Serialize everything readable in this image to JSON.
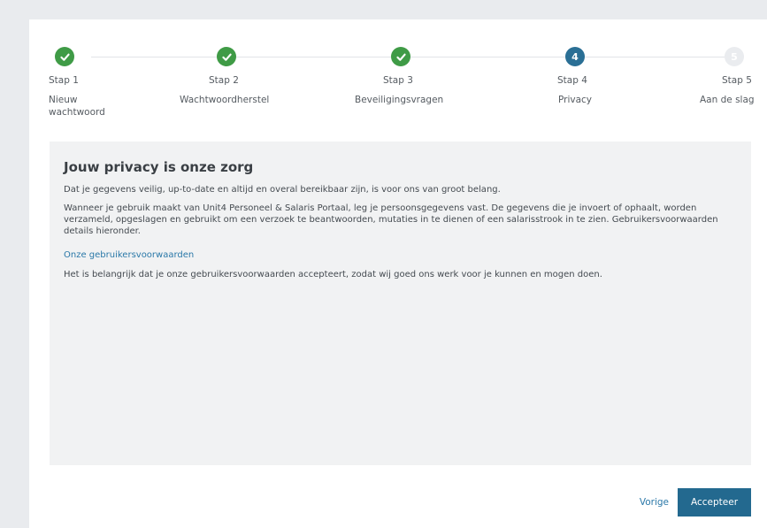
{
  "stepper": {
    "steps": [
      {
        "number": "1",
        "label": "Stap 1",
        "name": "Nieuw wachtwoord",
        "state": "done"
      },
      {
        "number": "2",
        "label": "Stap 2",
        "name": "Wachtwoordherstel",
        "state": "done"
      },
      {
        "number": "3",
        "label": "Stap 3",
        "name": "Beveiligingsvragen",
        "state": "done"
      },
      {
        "number": "4",
        "label": "Stap 4",
        "name": "Privacy",
        "state": "active"
      },
      {
        "number": "5",
        "label": "Stap 5",
        "name": "Aan de slag",
        "state": "future"
      }
    ]
  },
  "content": {
    "title": "Jouw privacy is onze zorg",
    "para1": "Dat je gegevens veilig, up-to-date en altijd en overal bereikbaar zijn, is voor ons van groot belang.",
    "para2": "Wanneer je gebruik maakt van Unit4 Personeel & Salaris Portaal, leg je persoonsgegevens vast. De gegevens die je invoert of ophaalt, worden verzameld, opgeslagen en gebruikt om een verzoek te beantwoorden, mutaties in te dienen of een salarisstrook in te zien. Gebruikersvoorwaarden details hieronder.",
    "terms_link": "Onze gebruikersvoorwaarden",
    "para3": "Het is belangrijk dat je onze gebruikersvoorwaarden accepteert, zodat wij goed ons werk voor je kunnen en mogen doen."
  },
  "footer": {
    "prev_label": "Vorige",
    "accept_label": "Accepteer"
  },
  "colors": {
    "done": "#3f9b46",
    "active": "#2a6f95",
    "future": "#eaecef",
    "link": "#2a78a8",
    "primary_button": "#23698f"
  }
}
